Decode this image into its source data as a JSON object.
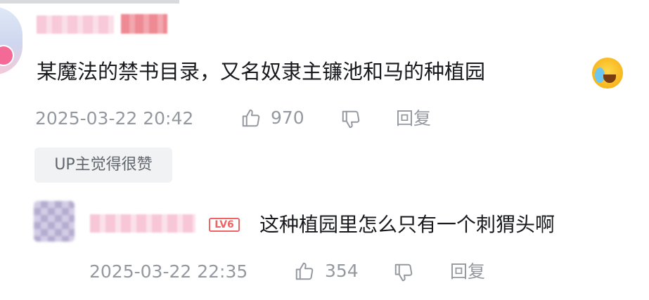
{
  "comment": {
    "text": "某魔法的禁书目录，又名奴隶主镰池和马的种植园",
    "emoji": "crying-laughing-emoji",
    "timestamp": "2025-03-22 20:42",
    "likes": "970",
    "reply_label": "回复",
    "up_badge": "UP主觉得很赞"
  },
  "reply": {
    "level": "LV6",
    "text": "这种植园里怎么只有一个刺猬头啊",
    "timestamp": "2025-03-22 22:35",
    "likes": "354",
    "reply_label": "回复"
  },
  "colors": {
    "meta_gray": "#9499a0",
    "level_red": "#ef6464",
    "badge_bg": "#f1f2f3"
  }
}
